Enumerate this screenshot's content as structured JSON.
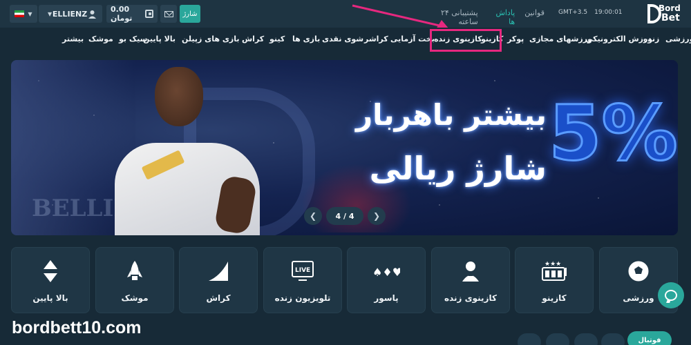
{
  "topbar": {
    "language_flag": "iran-flag-icon",
    "username": "ELLIENZ",
    "balance": "0.00 تومان",
    "deposit_label": "شارژ",
    "support": "پشتیبانی ۲۴ ساعته",
    "bonuses": "پاداش ها",
    "rules": "قوانین",
    "timezone": "GMT+3.5",
    "time": "19:00:01",
    "logo_line1": "Bord",
    "logo_line2": "Bet"
  },
  "nav": {
    "items": [
      "ورزشی",
      "زنده",
      "ورزش الکترونیکی",
      "ورزشهای مجازی",
      "پوکر",
      "کازینو",
      "کازینوی زنده",
      "بخت آزمایی",
      "کراشر",
      "شوی نقدی",
      "بازی ها",
      "کینو",
      "کراش",
      "بازی های زپیلن",
      "بالا پایین",
      "سیک بو",
      "موشک",
      "بیشتر"
    ]
  },
  "banner": {
    "line1": "بیشتر باهربار",
    "line2": "شارژ ریالی",
    "percent": "5%",
    "jersey_text": "BELLIN",
    "counter": "4 / 4"
  },
  "categories": [
    {
      "label": "ورزشی",
      "icon": "soccer-ball-icon"
    },
    {
      "label": "کازینو",
      "icon": "slot-machine-icon"
    },
    {
      "label": "کازینوی زنده",
      "icon": "dealer-icon"
    },
    {
      "label": "پاسور",
      "icon": "cards-icon"
    },
    {
      "label": "تلویزیون زنده",
      "icon": "live-tv-icon"
    },
    {
      "label": "کراش",
      "icon": "crash-chart-icon"
    },
    {
      "label": "موشک",
      "icon": "rocket-icon"
    },
    {
      "label": "بالا پایین",
      "icon": "up-down-icon"
    }
  ],
  "watermark": "bordbett10.com",
  "bottom": {
    "active_tab": "فوتبال"
  },
  "colors": {
    "accent": "#2aa79b",
    "highlight": "#e6287f",
    "background": "#172a37"
  }
}
